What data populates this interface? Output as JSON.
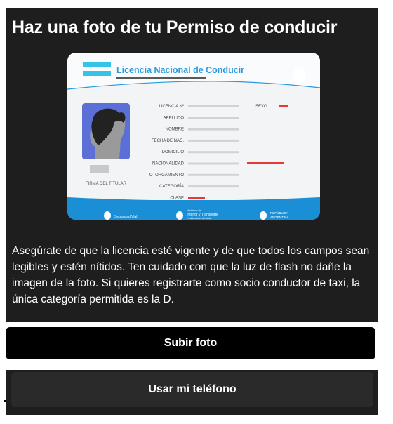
{
  "title": "Haz una foto de tu Permiso de conducir",
  "license_card": {
    "header": "Licencia Nacional de Conducir",
    "fields": [
      "LICENCIA Nº",
      "APELLIDO",
      "NOMBRE",
      "FECHA DE NAC.",
      "DOMICILIO",
      "NACIONALIDAD",
      "OTORGAMIENTO",
      "CATEGORÍA",
      "CLASE"
    ],
    "sex_label": "SEXO",
    "signature_label": "FIRMA DEL TITULAR",
    "footer": {
      "left": "Seguridad Vial",
      "middle_small": "Ministerio del",
      "middle_main": "Interior y Transporte",
      "middle_sub": "Presidencia de la Nación",
      "right_1": "REPÚBLICA",
      "right_2": "ARGENTINA"
    },
    "colors": {
      "accent": "#1b8fd6",
      "bar_cyan": "#35c3e8",
      "red": "#e53935",
      "photo_bg": "#5b6fd6"
    }
  },
  "instructions": "Asegúrate de que la licencia esté vigente y de que todos los campos sean legibles y estén nítidos. Ten cuidado con que la luz de flash no dañe la imagen de la foto. Si quieres registrarte como socio conductor de taxi, la única categoría permitida es la D.",
  "buttons": {
    "upload_label": "Subir foto",
    "phone_label": "Usar mi teléfono"
  }
}
